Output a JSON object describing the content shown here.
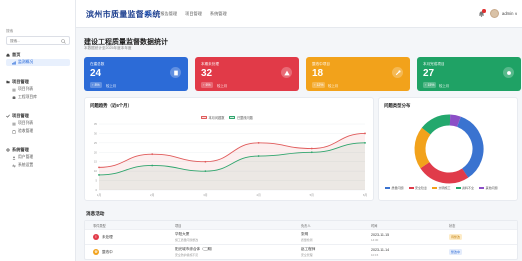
{
  "sidebar": {
    "search_label": "搜索",
    "search_placeholder": "搜索...",
    "groups": [
      {
        "label": "首页",
        "items": [
          {
            "label": "监测概况",
            "active": true
          }
        ]
      },
      {
        "label": "项目管理",
        "items": [
          {
            "label": "项目列表"
          },
          {
            "label": "工程项目库"
          }
        ]
      },
      {
        "label": "项目管理",
        "items": [
          {
            "label": "项目列表"
          },
          {
            "label": "验收管理"
          }
        ]
      },
      {
        "label": "系统管理",
        "items": [
          {
            "label": "用户管理"
          },
          {
            "label": "系统设置"
          }
        ]
      }
    ]
  },
  "topbar": {
    "brand": "滨州市质量监督系统",
    "nav": [
      {
        "label": "首页",
        "active": true
      },
      {
        "label": "报告管理"
      },
      {
        "label": "项目管理"
      },
      {
        "label": "系统管理"
      }
    ],
    "user": "admin ∨"
  },
  "page": {
    "title": "建设工程质量监督数据统计",
    "subtitle": "本数据统计至2025年度本年度"
  },
  "cards": [
    {
      "title": "在建总数",
      "value": "24",
      "badge": "↑ 8%",
      "note": "较上月",
      "color": "#2c6bd7",
      "icon": "doc-icon"
    },
    {
      "title": "本期未处理",
      "value": "32",
      "badge": "↑ 6%",
      "note": "较上月",
      "color": "#e13a48",
      "icon": "alert-icon"
    },
    {
      "title": "整改中项目",
      "value": "18",
      "badge": "↑ 12%",
      "note": "较上月",
      "color": "#f2a21b",
      "icon": "tool-icon"
    },
    {
      "title": "本月完成项目",
      "value": "27",
      "badge": "↑ 15%",
      "note": "较上月",
      "color": "#1fa265",
      "icon": "check-icon"
    }
  ],
  "trend_panel": {
    "title": "问题趋势（近6个月）"
  },
  "donut_panel": {
    "title": "问题类型分布"
  },
  "chart_data": [
    {
      "type": "area",
      "x": [
        "1月",
        "2月",
        "3月",
        "4月",
        "5月",
        "6月"
      ],
      "xlim": [
        0,
        5
      ],
      "ylim": [
        0,
        35
      ],
      "yticks": [
        0,
        5,
        10,
        15,
        20,
        25,
        30,
        35
      ],
      "grid": true,
      "legend_position": "top",
      "series": [
        {
          "name": "本月问题数",
          "values": [
            12,
            19,
            15,
            25,
            22,
            30
          ],
          "color": "#e05b5b"
        },
        {
          "name": "已整改问题",
          "values": [
            8,
            13,
            10,
            18,
            20,
            25
          ],
          "color": "#2fa56d"
        }
      ]
    },
    {
      "type": "pie",
      "donut": true,
      "legend_position": "bottom",
      "categories": [
        "质量问题",
        "安全隐患",
        "文明施工",
        "资料不全",
        "其他问题"
      ],
      "values": [
        35,
        25,
        20,
        15,
        5
      ],
      "colors": [
        "#3a73d0",
        "#e03b4a",
        "#f2a21b",
        "#23a86d",
        "#8c4fc7"
      ]
    }
  ],
  "activity": {
    "title": "消息活动",
    "columns": [
      "事件类型",
      "项目",
      "负责人",
      "时间",
      "状态"
    ],
    "rows": [
      {
        "type": "未处理",
        "type_color": "#e13a48",
        "project": "华阳大厦",
        "project_sub": "施工质量问题整改",
        "person": "张明",
        "person_sub": "质量检测",
        "date": "2023-11-15",
        "time": "14:30",
        "status": "待整改",
        "status_bg": "#fdecc8",
        "status_color": "#c07a00"
      },
      {
        "type": "整改中",
        "type_color": "#f2a21b",
        "project": "阳光城市综合体（二期）",
        "project_sub": "安全防护措施不足",
        "person": "赵工程师",
        "person_sub": "安全管理",
        "date": "2023-11-14",
        "time": "10:15",
        "status": "整改中",
        "status_bg": "#e4ecfb",
        "status_color": "#2c6bd7"
      }
    ]
  }
}
